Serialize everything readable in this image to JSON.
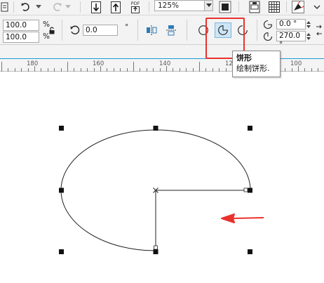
{
  "toolbar": {
    "zoom_value": "125%",
    "pdf_label": "PDF"
  },
  "property_bar": {
    "scale_x": "100.0",
    "scale_y": "100.0",
    "percent_symbol": "%",
    "rotation": "0.0",
    "rotation_unit": "°",
    "start_angle": "0.0 °",
    "end_angle": "270.0 °"
  },
  "ruler": {
    "labels": [
      "180",
      "160",
      "140",
      "12",
      "100"
    ]
  },
  "tooltip": {
    "title": "饼形",
    "description": "绘制饼形."
  },
  "colors": {
    "highlight": "#e8322d",
    "arrow": "#e8322d",
    "tool_active_bg": "#cde6f7",
    "tool_active_border": "#7fb4d9",
    "ruler_accent": "#1e9bd7"
  },
  "icons": {
    "undo": "undo-icon",
    "redo": "redo-icon",
    "import": "import-icon",
    "export": "export-icon",
    "publish_pdf": "pdf-icon",
    "full_screen": "full-screen-icon",
    "grid": "grid-icon",
    "lock_ratio": "lock-icon",
    "rotate": "rotate-icon",
    "ellipse": "ellipse-icon",
    "pie": "pie-icon",
    "arc": "arc-icon",
    "start_angle": "start-angle-icon",
    "end_angle": "end-angle-icon"
  }
}
